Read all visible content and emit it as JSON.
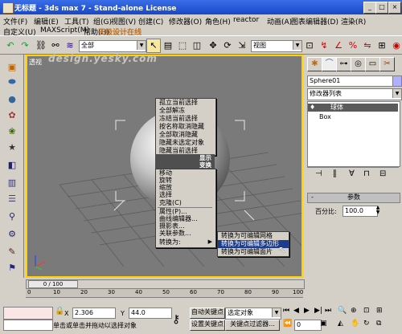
{
  "title": "无标题   - 3ds max 7   - Stand-alone License",
  "window_buttons": {
    "min": "_",
    "max": "□",
    "close": "×"
  },
  "menu": [
    "文件(F)",
    "编辑(E)",
    "工具(T)",
    "组(G)",
    "视图(V)",
    "创建(C)",
    "修改器(O)",
    "角色(H)",
    "reactor",
    "动画(A)",
    "图表编辑器(D)",
    "渲染(R)"
  ],
  "menu2": [
    "自定义(U)",
    "MAXScript(M)",
    "帮助(H)"
  ],
  "toolbar": {
    "selection_filter": "全部",
    "refcoord": "视图"
  },
  "watermark": {
    "line1": "天极设计在线",
    "line2": "design.yesky.com"
  },
  "viewport": {
    "label": "透视"
  },
  "quad": {
    "items_top": [
      "孤立当前选择",
      "全部解冻",
      "冻结当前选择",
      "按名称取消隐藏",
      "全部取消隐藏",
      "隐藏未选定对象",
      "隐藏当前选择"
    ],
    "display_header": "显示",
    "transform_header": "变换",
    "items_bottom": [
      "移动",
      "旋转",
      "缩放",
      "选择",
      "克隆(C)",
      "属性(P)...",
      "曲线编辑器...",
      "摄影表...",
      "关联参数...",
      "转换为:"
    ],
    "submenu": [
      "转换为可编辑网格",
      "转换为可编辑多边形",
      "转换为可编辑面片"
    ]
  },
  "right_panel": {
    "object_name": "Sphere01",
    "modifier_list": "修改器列表",
    "stack_item": "球体",
    "stack_sub": "Box",
    "rollout_title": "参数",
    "percent_label": "百分比:",
    "percent_value": "100.0"
  },
  "timeline": {
    "frame": "0 / 100",
    "ticks": [
      "0",
      "10",
      "20",
      "30",
      "40",
      "50",
      "60",
      "70",
      "80",
      "90",
      "100"
    ]
  },
  "status": {
    "x_value": "2.306",
    "y_value": "44.0",
    "auto_key": "自动关键点",
    "selected_objects": "选定对象",
    "set_key": "设置关键点",
    "key_filters": "关键点过滤器...",
    "prompt": "单击或单击并拖动以选择对象",
    "spinner_value": "0"
  },
  "colors": {
    "title_bar": "#1848c8",
    "viewport_bg": "#7a7a7a",
    "viewport_border": "#ffd200",
    "quad_header": "#4f4f4f",
    "highlight": "#1c3c8c"
  }
}
